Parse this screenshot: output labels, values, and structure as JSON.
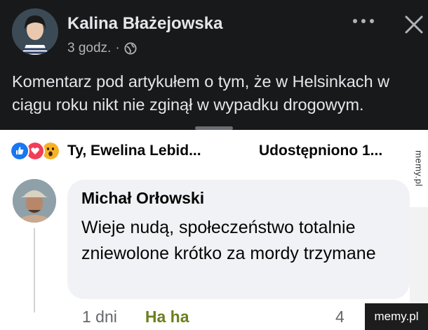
{
  "post": {
    "author": "Kalina Błażejowska",
    "time": "3 godz.",
    "separator": "·",
    "privacy_icon": "globe-icon",
    "text": "Komentarz pod artykułem o tym, że w Helsinkach w ciągu roku nikt nie zginął w wypadku drogowym."
  },
  "reactions": {
    "icons": [
      "like-icon",
      "love-icon",
      "wow-icon"
    ],
    "names": "Ty, Ewelina Lebid...",
    "shares": "Udostępniono 1..."
  },
  "comment": {
    "author": "Michał Orłowski",
    "text": "Wieje nudą, społeczeństwo totalnie zniewolone krótko za mordy trzymane",
    "time": "1 dni",
    "haha_label": "Ha ha",
    "reaction_count": "4"
  },
  "watermark": {
    "side": "memy.pl",
    "corner": "memy.pl"
  },
  "colors": {
    "dark_bg": "#18191a",
    "light_bg": "#ffffff",
    "bubble": "#f0f2f5",
    "haha": "#6b7f1c"
  }
}
